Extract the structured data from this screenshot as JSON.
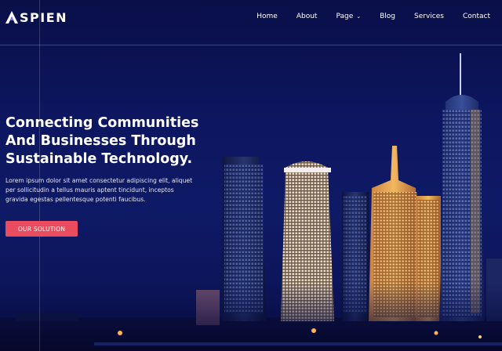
{
  "brand": {
    "name": "SPIEN",
    "logo_letter": "A"
  },
  "nav": {
    "items": [
      {
        "label": "Home"
      },
      {
        "label": "About"
      },
      {
        "label": "Page",
        "has_dropdown": true
      },
      {
        "label": "Blog"
      },
      {
        "label": "Services"
      },
      {
        "label": "Contact"
      }
    ]
  },
  "hero": {
    "headline_lines": [
      "Connecting Communities",
      "And Businesses Through",
      "Sustainable Technology."
    ],
    "description_lines": [
      "Lorem ipsum dolor sit amet consectetur adipiscing elit, aliquet",
      "per sollicitudin a tellus mauris aptent tincidunt, inceptos",
      "gravida egestas pellentesque potenti faucibus."
    ],
    "cta_label": "OUR SOLUTION"
  },
  "colors": {
    "background": "#0d1660",
    "accent": "#e94c5f",
    "text": "#ffffff"
  }
}
